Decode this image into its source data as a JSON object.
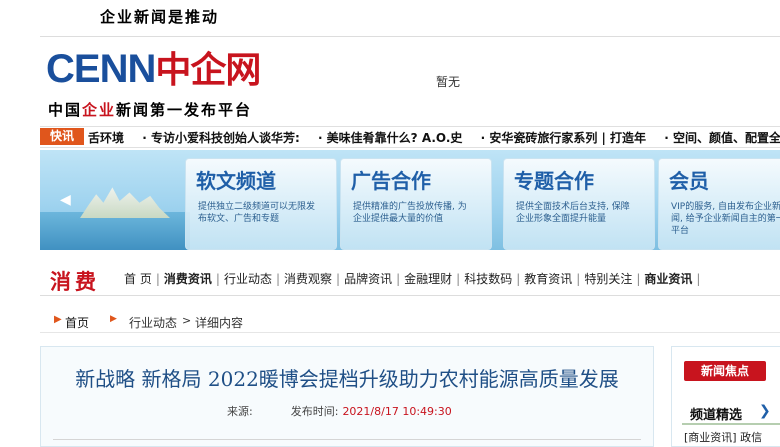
{
  "slogan": "企业新闻是推动",
  "logo": {
    "latin": "CENN",
    "cn": "中企网",
    "tagline_pre": "中国",
    "tagline_red": "企业",
    "tagline_post": "新闻第一发布平台"
  },
  "ad_placeholder": "暂无",
  "ticker": {
    "label": "快讯",
    "items": [
      "舌环境",
      "· 专访小爱科技创始人谈华芳:",
      "· 美味佳肴靠什么? A.O.史",
      "· 安华瓷砖旅行家系列 | 打造年",
      "· 空间、颜值、配置全要"
    ]
  },
  "banner": {
    "panels": [
      {
        "title": "软文频道",
        "desc": "提供独立二级频道可以无限发布软文、广告和专题"
      },
      {
        "title": "广告合作",
        "desc": "提供精准的广告投放传播, 为企业提供最大量的价值"
      },
      {
        "title": "专题合作",
        "desc": "提供全面技术后台支持, 保障企业形象全面提升能量"
      },
      {
        "title": "会员",
        "desc": "VIP的服务, 自由发布企业新闻, 给予企业新闻自主的第一平台"
      }
    ]
  },
  "nav": {
    "category": "消费",
    "links": [
      {
        "label": "首  页",
        "bold": false
      },
      {
        "label": "消费资讯",
        "bold": true
      },
      {
        "label": "行业动态",
        "bold": false
      },
      {
        "label": "消费观察",
        "bold": false
      },
      {
        "label": "品牌资讯",
        "bold": false
      },
      {
        "label": "金融理财",
        "bold": false
      },
      {
        "label": "科技数码",
        "bold": false
      },
      {
        "label": "教育资讯",
        "bold": false
      },
      {
        "label": "特别关注",
        "bold": false
      },
      {
        "label": "商业资讯",
        "bold": true
      }
    ]
  },
  "breadcrumb": {
    "home": "首页",
    "category": "行业动态",
    "detail": "详细内容"
  },
  "article": {
    "title": "新战略  新格局  2022暖博会提档升级助力农村能源高质量发展",
    "source_label": "来源:",
    "publish_label": "发布时间:",
    "publish_time": "2021/8/17 10:49:30"
  },
  "sidebar": {
    "news_focus": "新闻焦点",
    "channel_title": "频道精选",
    "channel_item": "[商业资讯] 政信"
  },
  "colors": {
    "brand_red": "#c8141e",
    "brand_blue": "#1a4f9c",
    "ticker_orange": "#e0561c",
    "title_blue": "#1f4f86"
  }
}
